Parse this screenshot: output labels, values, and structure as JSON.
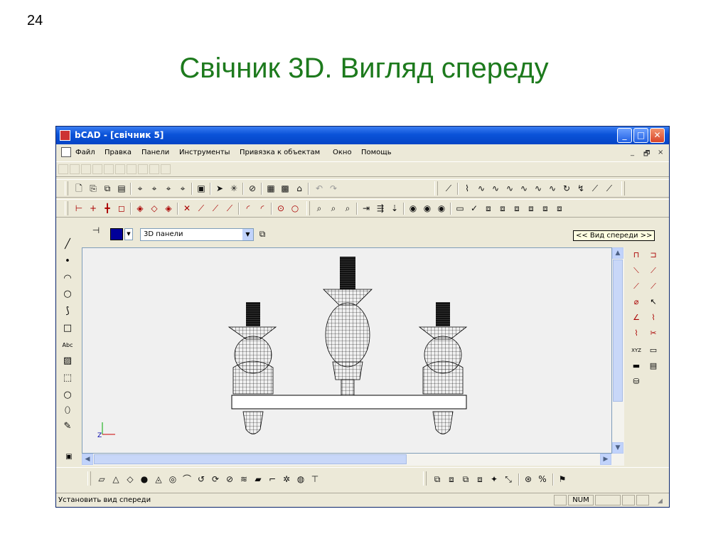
{
  "slide": {
    "number": "24",
    "title": "Свічник 3D. Вигляд спереду"
  },
  "window": {
    "title": "bCAD - [свічник 5]",
    "controls": {
      "minimize": "_",
      "maximize": "□",
      "close": "✕"
    }
  },
  "menu": {
    "items": [
      "Файл",
      "Правка",
      "Панели",
      "Инструменты",
      "Привязка к объектам",
      "Окно",
      "Помощь"
    ],
    "mdi_controls": [
      "_",
      "🗗",
      "×"
    ]
  },
  "toolbar": {
    "color": "#000099",
    "layer_select": "3D панели",
    "tooltip": "<< Вид спереди >>"
  },
  "status": {
    "text": "Установить вид спереди",
    "num": "NUM"
  },
  "colors": {
    "title_green": "#1d7a1d",
    "xp_blue": "#0a52d8",
    "axis_green": "#00aa00",
    "axis_red": "#cc0000"
  },
  "icons": {
    "toolbar_row1": [
      "new-icon",
      "copy-icon",
      "paste-icon",
      "doc-icon",
      "snap1-icon",
      "snap2-icon",
      "snap3-icon",
      "snap4-icon",
      "print-icon",
      "cursor-icon",
      "cursor2-icon",
      "clear-icon",
      "calc-icon",
      "disk-icon",
      "tool-icon",
      "undo-icon",
      "redo-icon"
    ],
    "toolbar_row2": [
      "line-icon",
      "plus-icon",
      "cross-icon",
      "box-icon",
      "diamond-icon",
      "diamond2-icon",
      "diamond3-icon",
      "x-icon",
      "arrow1-icon",
      "line2-icon",
      "line3-icon",
      "arc-icon",
      "arc2-icon",
      "target-icon",
      "circle-icon"
    ]
  }
}
